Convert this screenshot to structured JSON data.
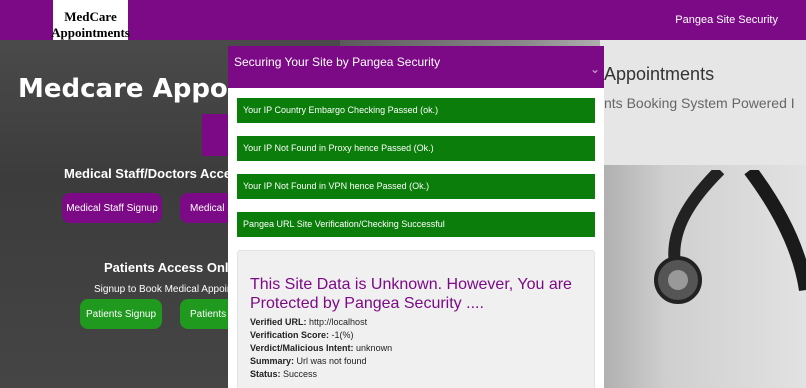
{
  "navbar": {
    "logo_line1": "MedCare",
    "logo_line2": "Appointments",
    "right_link": "Pangea Site Security"
  },
  "background": {
    "title": "Medcare Appointm",
    "staff_heading": "Medical Staff/Doctors Acce",
    "staff_signup": "Medical Staff Signup",
    "staff_login": "Medical S",
    "patients_heading": "Patients Access Only",
    "patients_sub": "Signup to Book Medical Appointme",
    "patients_signup": "Patients Signup",
    "patients_login": "Patients L",
    "hero_title": "Appointments",
    "hero_sub": "nts Booking System Powered I"
  },
  "modal": {
    "title": "Securing Your Site by Pangea Security",
    "close_icon": "chevron-down-icon",
    "checks": [
      "Your IP Country Embargo Checking Passed (ok.)",
      "Your IP Not Found in Proxy hence Passed (Ok.)",
      "Your IP Not Found in VPN hence Passed (Ok.)",
      "Pangea URL Site Verification/Checking Successful"
    ],
    "info": {
      "title": "This Site Data is Unknown. However, You are Protected by Pangea Security ....",
      "verified_url_label": "Verified URL:",
      "verified_url": "http://localhost",
      "score_label": "Verification Score:",
      "score": "-1(%)",
      "verdict_label": "Verdict/Malicious Intent:",
      "verdict": "unknown",
      "summary_label": "Summary:",
      "summary": "Url was not found",
      "status_label": "Status:",
      "status": "Success"
    }
  },
  "colors": {
    "brand_purple": "#7c0a86",
    "check_green": "#0a7d0a",
    "button_green": "#1f9a1f"
  }
}
